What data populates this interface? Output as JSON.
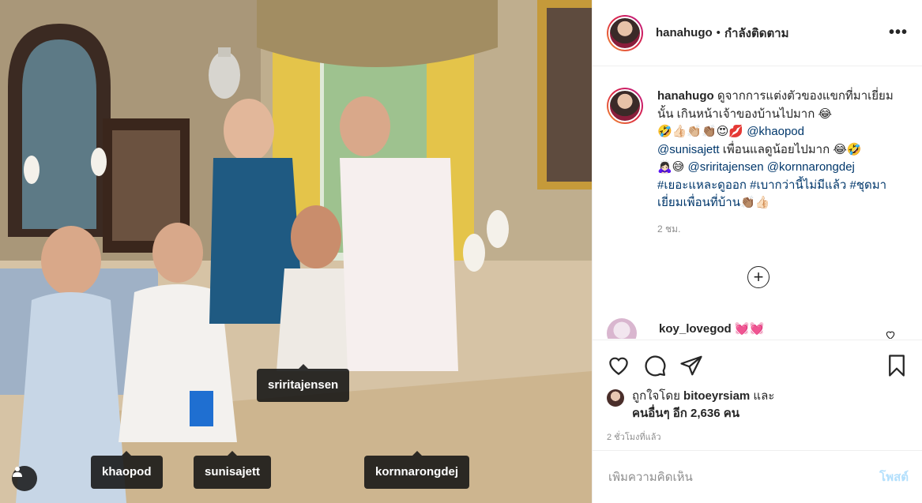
{
  "photo": {
    "tags": [
      "sriritajensen",
      "khaopod",
      "sunisajett",
      "kornnarongdej"
    ]
  },
  "header": {
    "username": "hanahugo",
    "dot": "•",
    "follow_status": "กำลังติดตาม",
    "more": "•••"
  },
  "caption": {
    "username": "hanahugo",
    "text_1": " ดูจากการแต่งตัวของแขกที่มาเยี่ยมนั้น เกินหน้าเจ้าของบ้านไปมาก 😂",
    "text_2": "🤣👍🏻👏🏼👏🏽😍💋 ",
    "mention_1": "@khaopod",
    "mention_2": "@sunisajett",
    "text_3": " เพื่อนแลดูน้อยไปมาก 😂🤣",
    "text_4": "🙇🏻‍♀️😅 ",
    "mention_3": "@sriritajensen",
    "mention_4": "@kornnarongdej",
    "hashtag_1": "#เยอะแหละดูออก",
    "hashtag_2": "#เบากว่านี้ไม่มีแล้ว",
    "hashtag_3": "#ชุดมาเยี่ยมเพื่อนที่บ้าน",
    "text_5": "👏🏽👍🏻",
    "time": "2 ชม."
  },
  "reply": {
    "username": "koy_lovegod",
    "emoji": " 💓💓"
  },
  "likes": {
    "prefix": "ถูกใจโดย ",
    "user": "bitoeyrsiam",
    "and": " และ",
    "others": "คนอื่นๆ อีก 2,636 คน"
  },
  "posted_ago": "2 ชั่วโมงที่แล้ว",
  "comment_box": {
    "placeholder": "เพิ่มความคิดเห็น",
    "post_label": "โพสต์"
  },
  "colors": {
    "link": "#00376b",
    "post_disabled": "#b2dffc",
    "muted": "#8e8e8e"
  }
}
